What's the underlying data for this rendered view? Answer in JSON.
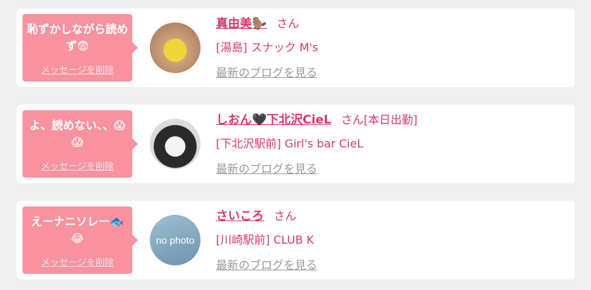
{
  "messages": [
    {
      "bubble_text": "恥ずかしながら読めず😨",
      "delete_label": "メッセージを削除",
      "avatar_alt": "",
      "name": "真由美🦫",
      "honorific": "さん",
      "status": "",
      "shop": "[湯島] スナック M's",
      "blog_link": "最新のブログを見る"
    },
    {
      "bubble_text": "よ、読めない、、😱😱",
      "delete_label": "メッセージを削除",
      "avatar_alt": "",
      "name": "しおん🖤下北沢CieL",
      "honorific": "さん",
      "status": "[本日出勤]",
      "shop": "[下北沢駅前] Girl's bar CieL",
      "blog_link": "最新のブログを見る"
    },
    {
      "bubble_text": "えーナニソレー🐟😂",
      "delete_label": "メッセージを削除",
      "avatar_alt": "no photo",
      "name": "さいころ",
      "honorific": "さん",
      "status": "",
      "shop": "[川崎駅前] CLUB K",
      "blog_link": "最新のブログを見る"
    }
  ]
}
